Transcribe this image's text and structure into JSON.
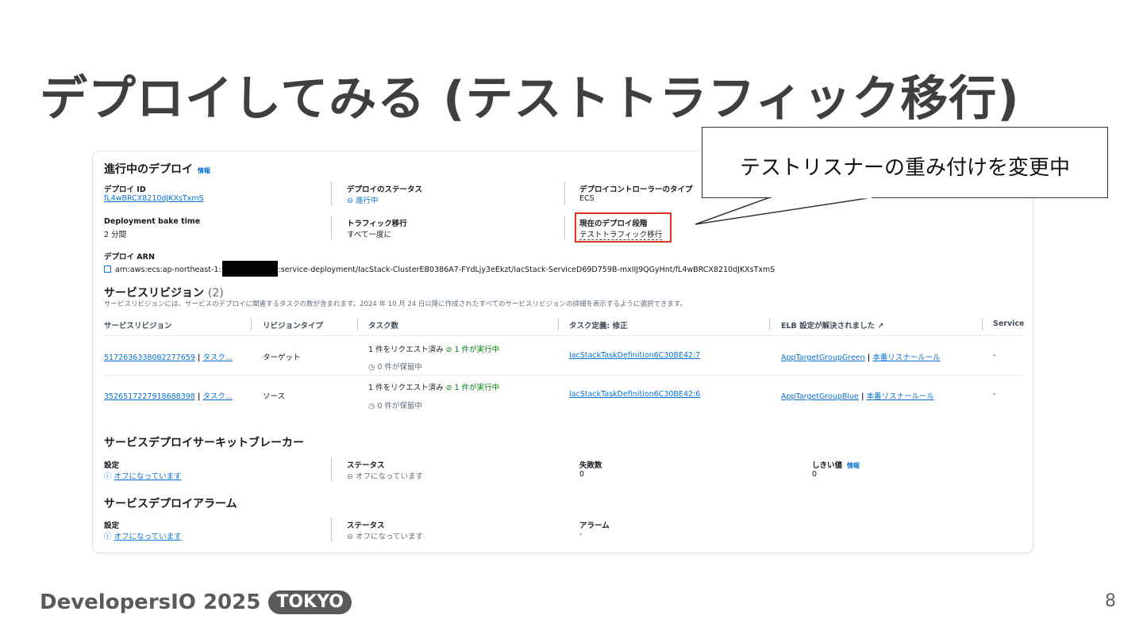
{
  "slide": {
    "title": "デプロイしてみる (テストトラフィック移行)",
    "callout": "テストリスナーの重み付けを変更中",
    "footer_logo": "DevelopersIO 2025",
    "footer_badge": "TOKYO",
    "page_number": "8"
  },
  "deploy": {
    "section_title": "進行中のデプロイ",
    "info": "情報",
    "id_label": "デプロイ ID",
    "id_value": "fL4wBRCX8210dJKXsTxmS",
    "status_label": "デプロイのステータス",
    "status_value": "進行中",
    "controller_label": "デプロイコントローラーのタイプ",
    "controller_value": "ECS",
    "bake_label": "Deployment bake time",
    "bake_value": "2 分間",
    "traffic_label": "トラフィック移行",
    "traffic_value": "すべて一度に",
    "phase_label": "現在のデプロイ段階",
    "phase_value": "テストトラフィック移行",
    "arn_label": "デプロイ ARN",
    "arn_prefix": "arn:aws:ecs:ap-northeast-1:",
    "arn_suffix": ":service-deployment/IacStack-ClusterEB0386A7-FYdLjy3eEkzt/IacStack-ServiceD69D759B-mxIIJ9QGyHnt/fL4wBRCX8210dJKXsTxmS"
  },
  "revisions": {
    "title": "サービスリビジョン",
    "count": "(2)",
    "description": "サービスリビジョンには、サービスのデプロイに関連するタスクの数が含まれます。2024 年 10 月 24 日以降に作成されたすべてのサービスリビジョンの詳細を表示するように選択できます。",
    "columns": [
      "サービスリビジョン",
      "リビジョンタイプ",
      "タスク数",
      "タスク定義: 修正",
      "ELB 設定が解決されました",
      "Service"
    ],
    "rows": [
      {
        "revision": "5172636338082277659",
        "task_link": "タスク...",
        "type": "ターゲット",
        "requested": "1 件をリクエスト済み",
        "running": "1 件が実行中",
        "pending": "0 件が保留中",
        "task_def": "IacStackTaskDefinition6C30BE42:7",
        "elb_group": "AppTargetGroupGreen",
        "elb_rule": "本番リスナールール",
        "service": "-"
      },
      {
        "revision": "3526517227918688398",
        "task_link": "タスク...",
        "type": "ソース",
        "requested": "1 件をリクエスト済み",
        "running": "1 件が実行中",
        "pending": "0 件が保留中",
        "task_def": "IacStackTaskDefinition6C30BE42:6",
        "elb_group": "AppTargetGroupBlue",
        "elb_rule": "本番リスナールール",
        "service": "-"
      }
    ]
  },
  "breaker": {
    "title": "サービスデプロイサーキットブレーカー",
    "setting_label": "設定",
    "setting_value": "オフになっています",
    "status_label": "ステータス",
    "status_value": "オフになっています",
    "failures_label": "失敗数",
    "failures_value": "0",
    "threshold_label": "しきい値",
    "threshold_info": "情報",
    "threshold_value": "0"
  },
  "alarm": {
    "title": "サービスデプロイアラーム",
    "setting_label": "設定",
    "setting_value": "オフになっています",
    "status_label": "ステータス",
    "status_value": "オフになっています",
    "alarm_label": "アラーム",
    "alarm_value": "-"
  },
  "colors": {
    "link": "#0972d3",
    "success": "#037f0c",
    "highlight": "#d9381e",
    "title": "#3f3f3f"
  }
}
